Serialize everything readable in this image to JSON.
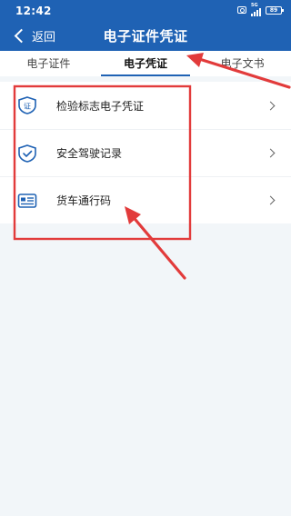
{
  "status_bar": {
    "time": "12:42",
    "network": "5G",
    "battery": "89"
  },
  "nav": {
    "back_label": "返回",
    "title": "电子证件凭证"
  },
  "tabs": [
    {
      "label": "电子证件",
      "active": false
    },
    {
      "label": "电子凭证",
      "active": true
    },
    {
      "label": "电子文书",
      "active": false
    }
  ],
  "list": {
    "items": [
      {
        "label": "检验标志电子凭证",
        "icon": "certificate-shield-icon",
        "icon_text": "证"
      },
      {
        "label": "安全驾驶记录",
        "icon": "shield-check-icon"
      },
      {
        "label": "货车通行码",
        "icon": "truck-pass-card-icon"
      }
    ]
  },
  "colors": {
    "header": "#1f62b4",
    "accent": "#1f62b4",
    "annotation": "#e23b3b",
    "background": "#f2f6f9"
  }
}
